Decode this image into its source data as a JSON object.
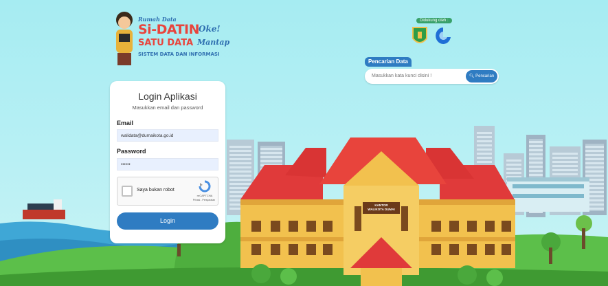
{
  "logo": {
    "small": "Rumah Data",
    "title": "Si-DATIN",
    "title_tag": "Oke!",
    "subtitle": "SATU DATA",
    "subtitle_tag": "Mantap",
    "tagline": "SISTEM DATA DAN INFORMASI"
  },
  "support": {
    "label": "Didukung oleh :"
  },
  "search": {
    "label": "Pencarian Data",
    "placeholder": "Masukkan kata kunci disini !",
    "button": "Pencarian"
  },
  "login": {
    "title": "Login Aplikasi",
    "subtitle": "Masukkan email dan password",
    "email_label": "Email",
    "email_value": "walidata@dumaikota.go.id",
    "password_label": "Password",
    "password_value": "••••••",
    "captcha_label": "Saya bukan robot",
    "captcha_brand": "reCAPTCHA",
    "captcha_links": "Privasi - Persyaratan",
    "button": "Login"
  },
  "building": {
    "sign_line1": "KANTOR",
    "sign_line2": "WALIKOTA DUMAI"
  },
  "colors": {
    "accent": "#2f7cc2",
    "sky": "#a6ecf2",
    "roof": "#e03a3a",
    "wall": "#f2c14e"
  }
}
